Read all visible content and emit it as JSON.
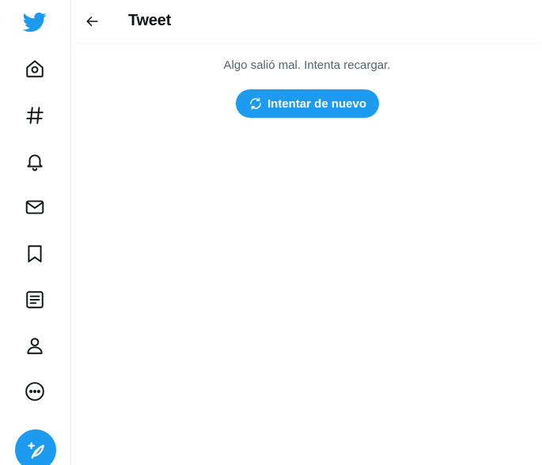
{
  "sidebar": {
    "logo_icon": "twitter-bird-icon",
    "items": [
      {
        "icon": "home-icon"
      },
      {
        "icon": "hashtag-icon"
      },
      {
        "icon": "bell-icon"
      },
      {
        "icon": "mail-icon"
      },
      {
        "icon": "bookmark-icon"
      },
      {
        "icon": "list-icon"
      },
      {
        "icon": "profile-icon"
      },
      {
        "icon": "more-icon"
      }
    ],
    "compose_icon": "feather-plus-icon"
  },
  "header": {
    "back_icon": "arrow-left-icon",
    "title": "Tweet"
  },
  "main": {
    "error_message": "Algo salió mal. Intenta recargar.",
    "retry_label": "Intentar de nuevo",
    "retry_icon": "refresh-icon"
  },
  "colors": {
    "accent": "#1d9bf0",
    "text": "#0f1419",
    "muted": "#536471",
    "border": "#eff3f4"
  }
}
